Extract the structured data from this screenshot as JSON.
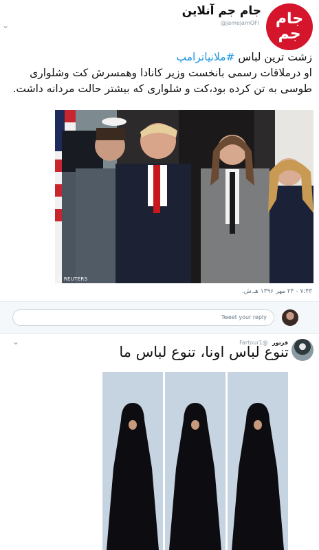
{
  "tweet1": {
    "account_name": "جام جم آنلاین",
    "account_handle": "@jamejamOFI",
    "logo_text": [
      "جام",
      "جم"
    ],
    "text_line1_prefix": "زشت ترین لباس",
    "hashtag": "#ملانیاترامپ",
    "text_line2": "او درملاقات رسمی بانخست وزیر کانادا وهمسرش کت وشلواری",
    "text_line3": "طوسی به تن کرده بود،کت و شلواری که بیشتر حالت مردانه داشت.",
    "photo_credit": "© REUTERS",
    "timestamp": "۷:۴۳ - ۲۴ مهر ۱۳۹۶ هـ.ش."
  },
  "reply": {
    "placeholder": "Tweet your reply"
  },
  "tweet2": {
    "author_name": "فرتور",
    "author_handle": "@Fartour1",
    "text": "تنوع لباس اونا، تنوع لباس ما"
  },
  "colors": {
    "hashtag": "#1b95e0",
    "brand_red": "#d4152b",
    "chador_bg": "#c5d4e0"
  }
}
